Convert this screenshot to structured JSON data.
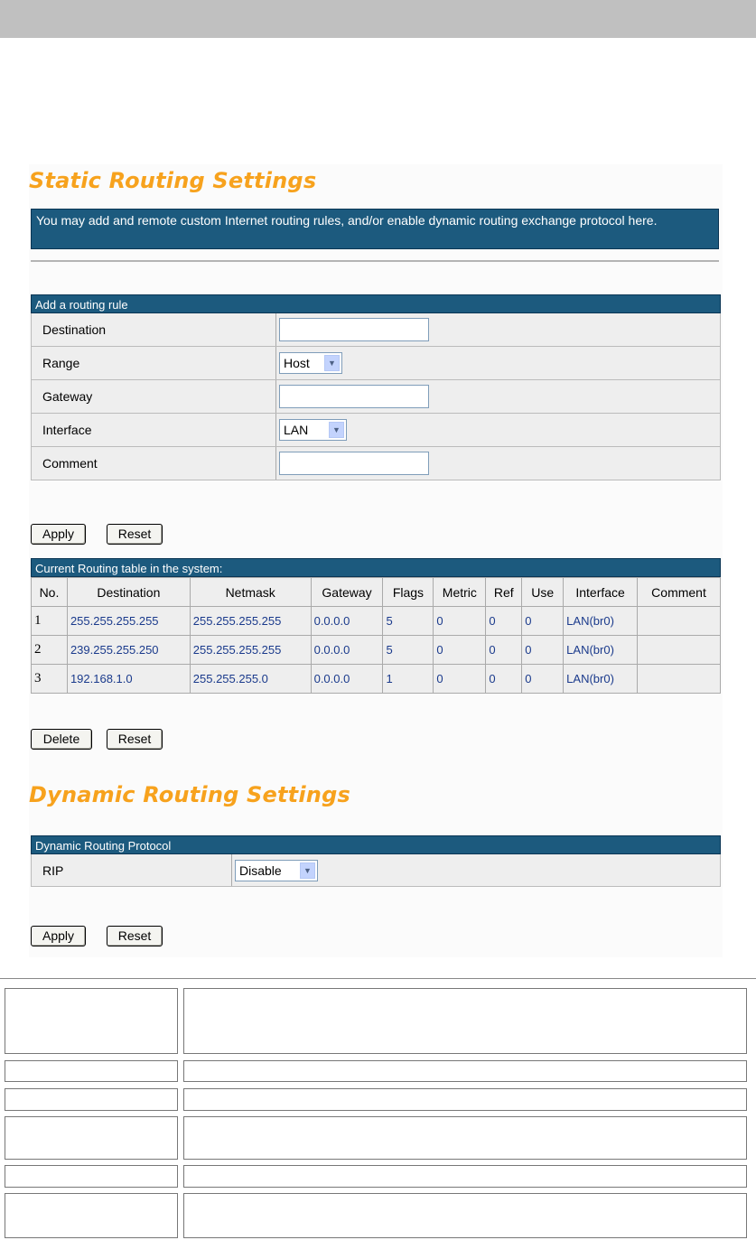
{
  "static_title": "Static Routing Settings",
  "info_text": "You may add and remote custom Internet routing rules, and/or enable dynamic routing exchange protocol here.",
  "add_rule": {
    "header": "Add a routing rule",
    "destination_label": "Destination",
    "destination_value": "",
    "range_label": "Range",
    "range_value": "Host",
    "gateway_label": "Gateway",
    "gateway_value": "",
    "interface_label": "Interface",
    "interface_value": "LAN",
    "comment_label": "Comment",
    "comment_value": "",
    "apply_label": "Apply",
    "reset_label": "Reset"
  },
  "routing_table": {
    "header": "Current Routing table in the system:",
    "columns": [
      "No.",
      "Destination",
      "Netmask",
      "Gateway",
      "Flags",
      "Metric",
      "Ref",
      "Use",
      "Interface",
      "Comment"
    ],
    "rows": [
      [
        "1",
        "255.255.255.255",
        "255.255.255.255",
        "0.0.0.0",
        "5",
        "0",
        "0",
        "0",
        "LAN(br0)",
        ""
      ],
      [
        "2",
        "239.255.255.250",
        "255.255.255.255",
        "0.0.0.0",
        "5",
        "0",
        "0",
        "0",
        "LAN(br0)",
        ""
      ],
      [
        "3",
        "192.168.1.0",
        "255.255.255.0",
        "0.0.0.0",
        "1",
        "0",
        "0",
        "0",
        "LAN(br0)",
        ""
      ]
    ],
    "delete_label": "Delete",
    "reset_label": "Reset"
  },
  "dynamic_title": "Dynamic Routing Settings",
  "dynamic": {
    "header": "Dynamic Routing Protocol",
    "rip_label": "RIP",
    "rip_value": "Disable",
    "apply_label": "Apply",
    "reset_label": "Reset"
  },
  "colors": {
    "accent_title": "#f7a21d",
    "header_bg": "#1c5a7e",
    "cell_text": "#1a3a8c"
  }
}
